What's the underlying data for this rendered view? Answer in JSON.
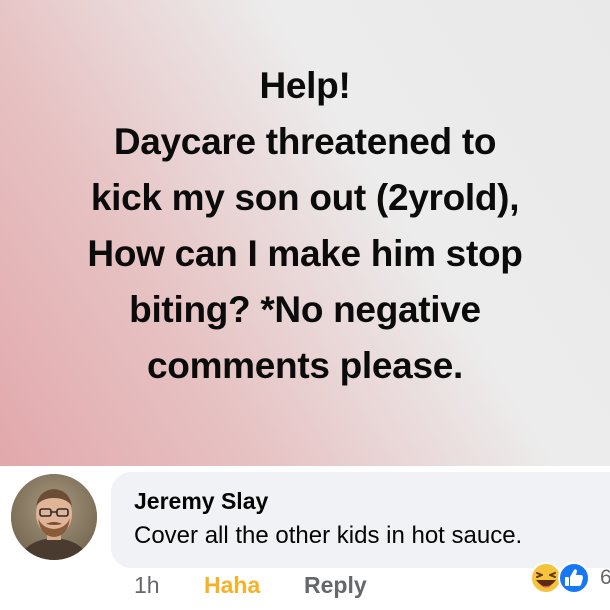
{
  "post": {
    "lines": [
      "Help!",
      "Daycare threatened to",
      "kick my son out (2yrold),",
      "How can I make him stop",
      "biting? *No negative",
      "comments please."
    ]
  },
  "comment": {
    "author": "Jeremy Slay",
    "text": "Cover all the other kids in hot sauce.",
    "time": "1h",
    "reaction_label": "Haha",
    "reply_label": "Reply",
    "reaction_count": "6",
    "reaction_icons": [
      "haha-emoji-icon",
      "like-thumb-icon"
    ],
    "colors": {
      "haha": "#f7b125",
      "like": "#1877f2",
      "bubble": "#f0f2f5"
    }
  }
}
